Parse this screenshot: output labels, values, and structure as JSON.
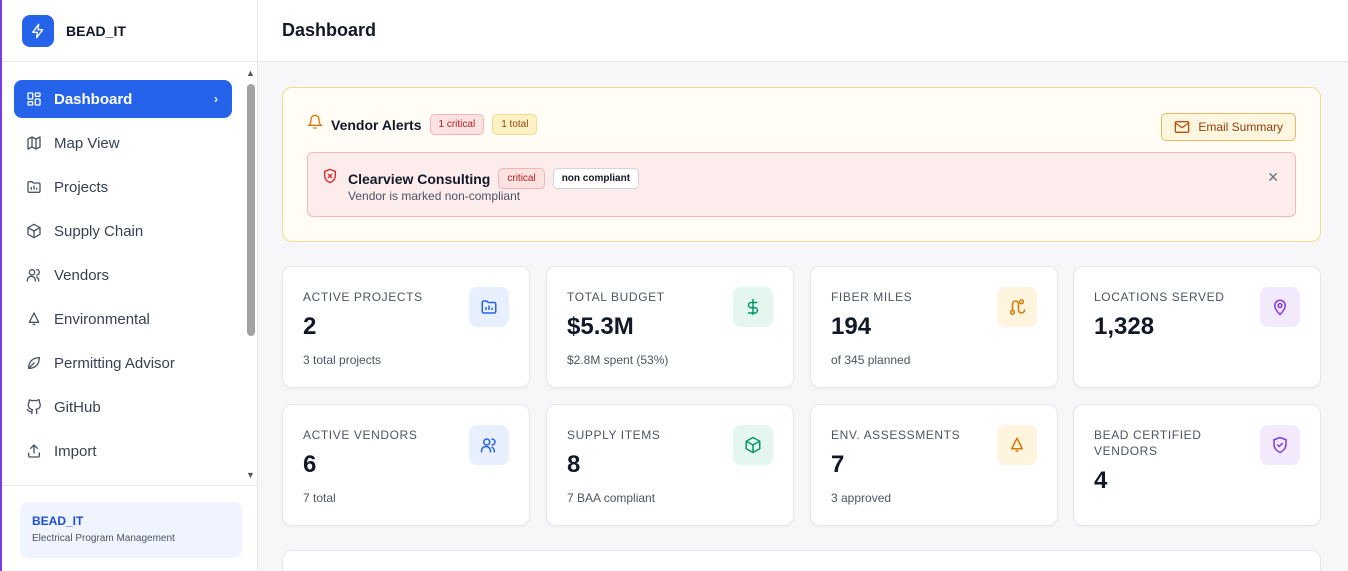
{
  "app": {
    "name": "BEAD_IT"
  },
  "sidebar": {
    "items": [
      {
        "label": "Dashboard",
        "icon": "grid-icon",
        "active": true
      },
      {
        "label": "Map View",
        "icon": "map-icon"
      },
      {
        "label": "Projects",
        "icon": "folder-chart-icon"
      },
      {
        "label": "Supply Chain",
        "icon": "box-icon"
      },
      {
        "label": "Vendors",
        "icon": "users-icon"
      },
      {
        "label": "Environmental",
        "icon": "bell-triangle-icon"
      },
      {
        "label": "Permitting Advisor",
        "icon": "leaf-icon"
      },
      {
        "label": "GitHub",
        "icon": "github-icon"
      },
      {
        "label": "Import",
        "icon": "upload-icon"
      }
    ],
    "footer": {
      "title": "BEAD_IT",
      "subtitle": "Electrical Program Management"
    }
  },
  "header": {
    "title": "Dashboard"
  },
  "alerts": {
    "title": "Vendor Alerts",
    "critical_badge": "1 critical",
    "total_badge": "1 total",
    "email_button": "Email Summary",
    "items": [
      {
        "vendor": "Clearview Consulting",
        "severity": "critical",
        "status": "non compliant",
        "message": "Vendor is marked non-compliant"
      }
    ]
  },
  "stats": [
    {
      "label": "ACTIVE PROJECTS",
      "value": "2",
      "sub": "3 total projects",
      "icon": "folder-chart-icon",
      "bg": "#e8efff",
      "fg": "#2563eb"
    },
    {
      "label": "TOTAL BUDGET",
      "value": "$5.3M",
      "sub": "$2.8M spent (53%)",
      "icon": "dollar-icon",
      "bg": "#e4f7ee",
      "fg": "#059669"
    },
    {
      "label": "FIBER MILES",
      "value": "194",
      "sub": "of 345 planned",
      "icon": "route-icon",
      "bg": "#fff4dd",
      "fg": "#d97706"
    },
    {
      "label": "LOCATIONS SERVED",
      "value": "1,328",
      "sub": "",
      "icon": "map-pin-icon",
      "bg": "#f3eaff",
      "fg": "#7c3aed"
    },
    {
      "label": "ACTIVE VENDORS",
      "value": "6",
      "sub": "7 total",
      "icon": "users-icon",
      "bg": "#e8efff",
      "fg": "#2563eb"
    },
    {
      "label": "SUPPLY ITEMS",
      "value": "8",
      "sub": "7 BAA compliant",
      "icon": "box-icon",
      "bg": "#e4f7ee",
      "fg": "#059669"
    },
    {
      "label": "ENV. ASSESSMENTS",
      "value": "7",
      "sub": "3 approved",
      "icon": "bell-triangle-icon",
      "bg": "#fff4dd",
      "fg": "#d97706"
    },
    {
      "label": "BEAD CERTIFIED VENDORS",
      "value": "4",
      "sub": "",
      "icon": "shield-check-icon",
      "bg": "#f3eaff",
      "fg": "#7c3aed"
    }
  ]
}
